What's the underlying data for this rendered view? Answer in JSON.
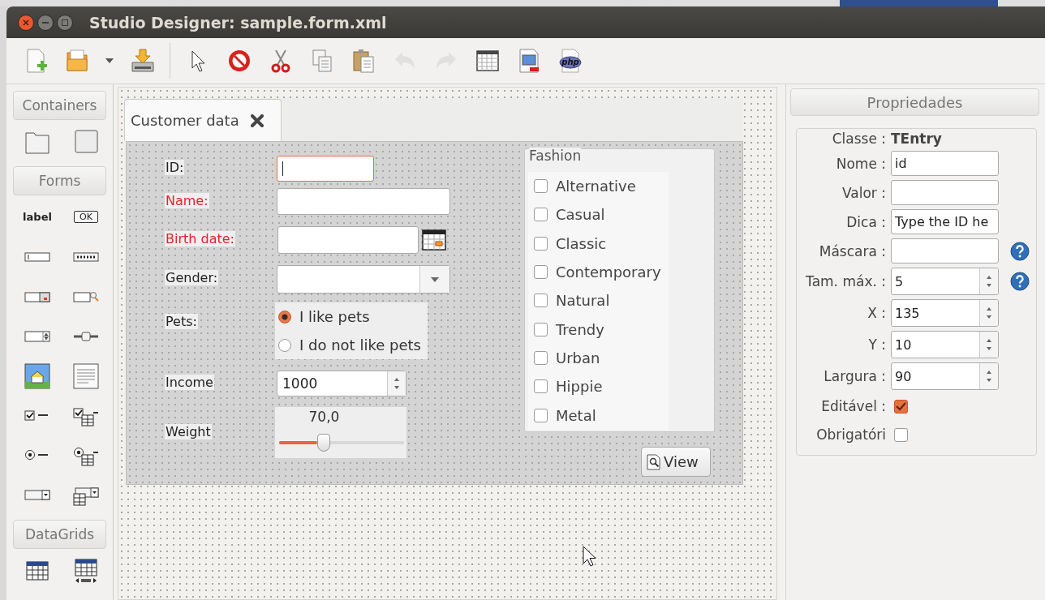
{
  "window": {
    "title": "Studio Designer: sample.form.xml"
  },
  "toolbar": [
    {
      "kind": "new",
      "disabled": false
    },
    {
      "kind": "open",
      "disabled": false
    },
    {
      "kind": "dropdown",
      "disabled": false
    },
    {
      "kind": "save",
      "disabled": false
    },
    {
      "kind": "separator"
    },
    {
      "kind": "pointer",
      "disabled": false
    },
    {
      "kind": "stop",
      "disabled": false
    },
    {
      "kind": "cut",
      "disabled": false
    },
    {
      "kind": "copy",
      "disabled": false
    },
    {
      "kind": "paste",
      "disabled": false
    },
    {
      "kind": "undo",
      "disabled": true
    },
    {
      "kind": "redo",
      "disabled": true
    },
    {
      "kind": "grid",
      "disabled": false
    },
    {
      "kind": "image",
      "disabled": false
    },
    {
      "kind": "php",
      "label": "php",
      "disabled": false
    }
  ],
  "palette": [
    {
      "title": "Containers",
      "items": [
        {
          "kind": "folder"
        },
        {
          "kind": "frame"
        }
      ]
    },
    {
      "title": "Forms",
      "items": [
        {
          "kind": "label",
          "text": "label"
        },
        {
          "kind": "button",
          "text": "OK"
        },
        {
          "kind": "entry"
        },
        {
          "kind": "password"
        },
        {
          "kind": "date"
        },
        {
          "kind": "seek"
        },
        {
          "kind": "spin"
        },
        {
          "kind": "slider"
        },
        {
          "kind": "image"
        },
        {
          "kind": "text"
        },
        {
          "kind": "check"
        },
        {
          "kind": "checkgroup"
        },
        {
          "kind": "radio"
        },
        {
          "kind": "radiogroup"
        },
        {
          "kind": "combo"
        },
        {
          "kind": "dbcombo"
        }
      ]
    },
    {
      "title": "DataGrids",
      "items": [
        {
          "kind": "grid"
        },
        {
          "kind": "pagegrid"
        }
      ]
    }
  ],
  "form": {
    "tab": {
      "label": "Customer data",
      "selected": true
    },
    "fields": [
      {
        "label": "ID:",
        "required": false,
        "kind": "entry",
        "focused": true
      },
      {
        "label": "Name:",
        "required": true,
        "kind": "entry",
        "focused": false
      },
      {
        "label": "Birth date:",
        "required": true,
        "kind": "date",
        "focused": false
      },
      {
        "label": "Gender:",
        "required": false,
        "kind": "combo",
        "focused": false
      },
      {
        "label": "Pets:",
        "required": false,
        "kind": "radio",
        "options": [
          {
            "label": "I like pets",
            "selected": true
          },
          {
            "label": "I do not like pets",
            "selected": false
          }
        ]
      },
      {
        "label": "Income",
        "required": false,
        "kind": "spin",
        "focused": false,
        "value": "1000"
      },
      {
        "label": "Weight",
        "required": false,
        "kind": "slider",
        "reading": "70,0",
        "level": 0.36
      }
    ],
    "fashion": {
      "title": "Fashion",
      "options": [
        {
          "label": "Alternative",
          "checked": false
        },
        {
          "label": "Casual",
          "checked": false
        },
        {
          "label": "Classic",
          "checked": false
        },
        {
          "label": "Contemporary",
          "checked": false
        },
        {
          "label": "Natural",
          "checked": false
        },
        {
          "label": "Trendy",
          "checked": false
        },
        {
          "label": "Urban",
          "checked": false
        },
        {
          "label": "Hippie",
          "checked": false
        },
        {
          "label": "Metal",
          "checked": false
        }
      ]
    },
    "view_button": {
      "label": "View"
    }
  },
  "properties": {
    "title": "Propriedades",
    "rows": [
      {
        "label": "Classe :",
        "kind": "text",
        "value": "TEntry",
        "help": false
      },
      {
        "label": "Nome :",
        "kind": "input",
        "value": "id",
        "help": false
      },
      {
        "label": "Valor :",
        "kind": "input",
        "help": false
      },
      {
        "label": "Dica :",
        "kind": "input",
        "value": "Type the ID he",
        "help": false
      },
      {
        "label": "Máscara :",
        "kind": "input",
        "help": true
      },
      {
        "label": "Tam. máx. :",
        "kind": "spin",
        "value": "5",
        "help": true
      },
      {
        "label": "X :",
        "kind": "spin",
        "value": "135",
        "help": false
      },
      {
        "label": "Y :",
        "kind": "spin",
        "value": "10",
        "help": false
      },
      {
        "label": "Largura :",
        "kind": "spin",
        "value": "90",
        "help": false
      },
      {
        "label": "Editável :",
        "kind": "check",
        "checked": true,
        "help": false
      },
      {
        "label": "Obrigatóri",
        "kind": "check",
        "checked": false,
        "help": false
      }
    ]
  }
}
